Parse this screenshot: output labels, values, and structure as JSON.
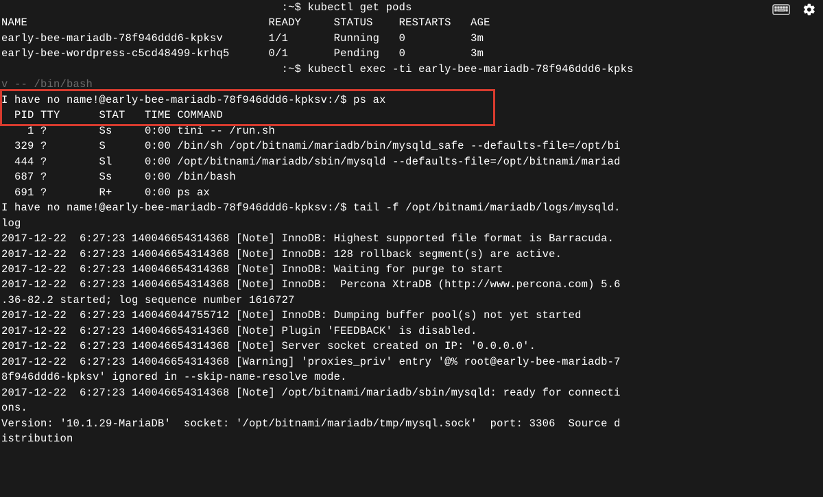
{
  "prompt1": ":~$ kubectl get pods",
  "pods_header": "NAME                                     READY     STATUS    RESTARTS   AGE",
  "pods_rows": [
    "early-bee-mariadb-78f946ddd6-kpksv       1/1       Running   0          3m",
    "early-bee-wordpress-c5cd48499-krhq5      0/1       Pending   0          3m"
  ],
  "prompt2": ":~$ kubectl exec -ti early-bee-mariadb-78f946ddd6-kpks",
  "bashfrag": "v -- /bin/bash",
  "highlight_line": "I have no name!@early-bee-mariadb-78f946ddd6-kpksv:/$ ps ax",
  "ps_header": "  PID TTY      STAT   TIME COMMAND",
  "ps_rows": [
    "    1 ?        Ss     0:00 tini -- /run.sh",
    "  329 ?        S      0:00 /bin/sh /opt/bitnami/mariadb/bin/mysqld_safe --defaults-file=/opt/bi",
    "  444 ?        Sl     0:00 /opt/bitnami/mariadb/sbin/mysqld --defaults-file=/opt/bitnami/mariad",
    "  687 ?        Ss     0:00 /bin/bash",
    "  691 ?        R+     0:00 ps ax"
  ],
  "tail_prompt": "I have no name!@early-bee-mariadb-78f946ddd6-kpksv:/$ tail -f /opt/bitnami/mariadb/logs/mysqld.",
  "tail_prompt2": "log",
  "log_lines": [
    "2017-12-22  6:27:23 140046654314368 [Note] InnoDB: Highest supported file format is Barracuda.",
    "2017-12-22  6:27:23 140046654314368 [Note] InnoDB: 128 rollback segment(s) are active.",
    "2017-12-22  6:27:23 140046654314368 [Note] InnoDB: Waiting for purge to start",
    "2017-12-22  6:27:23 140046654314368 [Note] InnoDB:  Percona XtraDB (http://www.percona.com) 5.6",
    ".36-82.2 started; log sequence number 1616727",
    "2017-12-22  6:27:23 140046044755712 [Note] InnoDB: Dumping buffer pool(s) not yet started",
    "2017-12-22  6:27:23 140046654314368 [Note] Plugin 'FEEDBACK' is disabled.",
    "2017-12-22  6:27:23 140046654314368 [Note] Server socket created on IP: '0.0.0.0'.",
    "2017-12-22  6:27:23 140046654314368 [Warning] 'proxies_priv' entry '@% root@early-bee-mariadb-7",
    "8f946ddd6-kpksv' ignored in --skip-name-resolve mode.",
    "2017-12-22  6:27:23 140046654314368 [Note] /opt/bitnami/mariadb/sbin/mysqld: ready for connecti",
    "ons.",
    "Version: '10.1.29-MariaDB'  socket: '/opt/bitnami/mariadb/tmp/mysql.sock'  port: 3306  Source d",
    "istribution"
  ]
}
